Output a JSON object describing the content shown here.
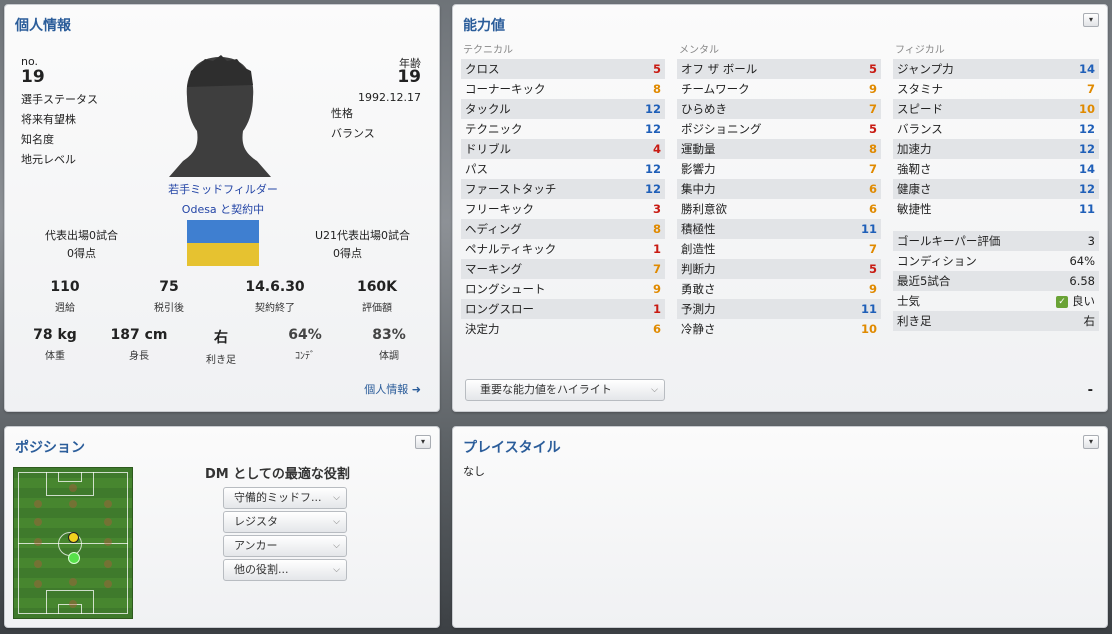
{
  "personal": {
    "title": "個人情報",
    "no_label": "no.",
    "no_value": "19",
    "age_label": "年齢",
    "age_value": "19",
    "birthdate": "1992.12.17",
    "left_labels": [
      "選手ステータス",
      "将来有望株",
      "知名度",
      "地元レベル"
    ],
    "personality_label": "性格",
    "personality_value": "バランス",
    "position": "若手ミッドフィルダー",
    "contract": "Odesa と契約中",
    "intl_caps": "代表出場0試合",
    "intl_goals": "0得点",
    "u21_caps": "U21代表出場0試合",
    "u21_goals": "0得点",
    "stats_row1": [
      {
        "value": "110",
        "label": "週給"
      },
      {
        "value": "75",
        "label": "税引後"
      },
      {
        "value": "14.6.30",
        "label": "契約終了"
      },
      {
        "value": "160K",
        "label": "評価額"
      }
    ],
    "stats_row2": [
      {
        "value": "78 kg",
        "label": "体重"
      },
      {
        "value": "187 cm",
        "label": "身長"
      },
      {
        "value": "右",
        "label": "利き足"
      },
      {
        "value": "64%",
        "label": "ｺﾝﾃﾞ"
      },
      {
        "value": "83%",
        "label": "体調"
      }
    ],
    "link": "個人情報 ➜",
    "flag_colors": [
      "#3f7fd0",
      "#e6c230"
    ]
  },
  "attributes": {
    "title": "能力値",
    "technical": {
      "header": "テクニカル",
      "rows": [
        {
          "name": "クロス",
          "value": "5",
          "color": "red"
        },
        {
          "name": "コーナーキック",
          "value": "8",
          "color": "org"
        },
        {
          "name": "タックル",
          "value": "12",
          "color": "blu"
        },
        {
          "name": "テクニック",
          "value": "12",
          "color": "blu"
        },
        {
          "name": "ドリブル",
          "value": "4",
          "color": "red"
        },
        {
          "name": "パス",
          "value": "12",
          "color": "blu"
        },
        {
          "name": "ファーストタッチ",
          "value": "12",
          "color": "blu"
        },
        {
          "name": "フリーキック",
          "value": "3",
          "color": "red"
        },
        {
          "name": "ヘディング",
          "value": "8",
          "color": "org"
        },
        {
          "name": "ペナルティキック",
          "value": "1",
          "color": "red"
        },
        {
          "name": "マーキング",
          "value": "7",
          "color": "org"
        },
        {
          "name": "ロングシュート",
          "value": "9",
          "color": "org"
        },
        {
          "name": "ロングスロー",
          "value": "1",
          "color": "red"
        },
        {
          "name": "決定力",
          "value": "6",
          "color": "org"
        }
      ]
    },
    "mental": {
      "header": "メンタル",
      "rows": [
        {
          "name": "オフ ザ ボール",
          "value": "5",
          "color": "red"
        },
        {
          "name": "チームワーク",
          "value": "9",
          "color": "org"
        },
        {
          "name": "ひらめき",
          "value": "7",
          "color": "org"
        },
        {
          "name": "ポジショニング",
          "value": "5",
          "color": "red"
        },
        {
          "name": "運動量",
          "value": "8",
          "color": "org"
        },
        {
          "name": "影響力",
          "value": "7",
          "color": "org"
        },
        {
          "name": "集中力",
          "value": "6",
          "color": "org"
        },
        {
          "name": "勝利意欲",
          "value": "6",
          "color": "org"
        },
        {
          "name": "積極性",
          "value": "11",
          "color": "blu"
        },
        {
          "name": "創造性",
          "value": "7",
          "color": "org"
        },
        {
          "name": "判断力",
          "value": "5",
          "color": "red"
        },
        {
          "name": "勇敢さ",
          "value": "9",
          "color": "org"
        },
        {
          "name": "予測力",
          "value": "11",
          "color": "blu"
        },
        {
          "name": "冷静さ",
          "value": "10",
          "color": "org"
        }
      ]
    },
    "physical": {
      "header": "フィジカル",
      "rows": [
        {
          "name": "ジャンプ力",
          "value": "14",
          "color": "blu"
        },
        {
          "name": "スタミナ",
          "value": "7",
          "color": "org"
        },
        {
          "name": "スピード",
          "value": "10",
          "color": "org"
        },
        {
          "name": "バランス",
          "value": "12",
          "color": "blu"
        },
        {
          "name": "加速力",
          "value": "12",
          "color": "blu"
        },
        {
          "name": "強靭さ",
          "value": "14",
          "color": "blu"
        },
        {
          "name": "健康さ",
          "value": "12",
          "color": "blu"
        },
        {
          "name": "敏捷性",
          "value": "11",
          "color": "blu"
        }
      ]
    },
    "extra": [
      {
        "name": "ゴールキーパー評価",
        "value": "3"
      },
      {
        "name": "コンディション",
        "value": "64%"
      },
      {
        "name": "最近5試合",
        "value": "6.58"
      },
      {
        "name": "士気",
        "value": "良い",
        "badge": "✓"
      },
      {
        "name": "利き足",
        "value": "右"
      }
    ],
    "highlight_label": "重要な能力値をハイライト",
    "dash": "-"
  },
  "position": {
    "title": "ポジション",
    "role_title": "DM としての最適な役割",
    "roles": [
      "守備的ミッドフ...",
      "レジスタ",
      "アンカー",
      "他の役割..."
    ]
  },
  "playstyle": {
    "title": "プレイスタイル",
    "value": "なし"
  },
  "menu_glyph": "▾",
  "colors": {
    "title_blue": "#2b5d9a",
    "red": "#c81a12",
    "orange": "#e08a00",
    "blue": "#1f5fb8"
  }
}
